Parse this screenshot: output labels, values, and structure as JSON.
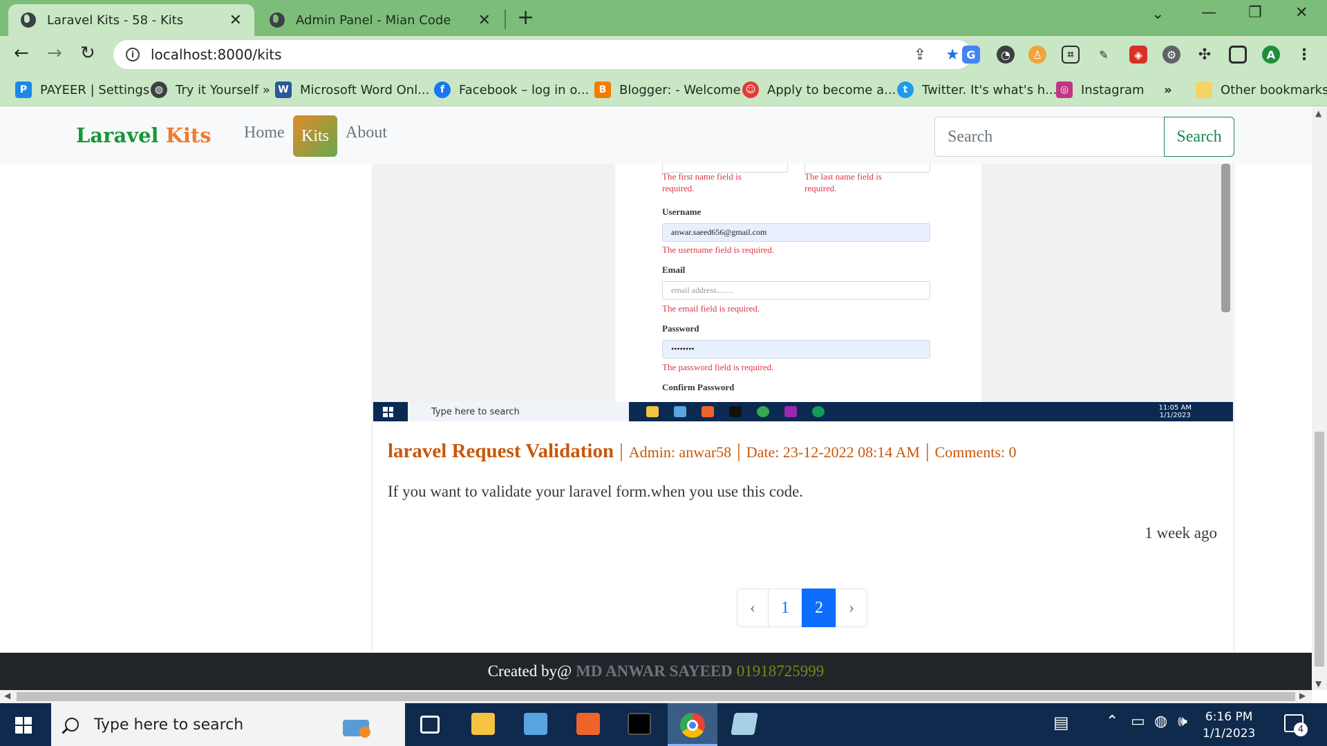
{
  "browser": {
    "tabs": [
      {
        "title": "Laravel Kits - 58 - Kits",
        "active": true
      },
      {
        "title": "Admin Panel - Mian Code",
        "active": false
      }
    ],
    "url": "localhost:8000/kits",
    "bookmarks": [
      {
        "label": "PAYEER | Settings",
        "icon": "payeer-icon",
        "color": "#1e88e5"
      },
      {
        "label": "Try it Yourself »",
        "icon": "globe-icon",
        "color": "#3c4043"
      },
      {
        "label": "Microsoft Word Onl...",
        "icon": "word-icon",
        "color": "#2b579a"
      },
      {
        "label": "Facebook – log in o...",
        "icon": "facebook-icon",
        "color": "#1877f2"
      },
      {
        "label": "Blogger: - Welcome",
        "icon": "blogger-icon",
        "color": "#f57c00"
      },
      {
        "label": "Apply to become a...",
        "icon": "smiley-icon",
        "color": "#e53935"
      },
      {
        "label": "Twitter. It's what's h...",
        "icon": "twitter-icon",
        "color": "#1d9bf0"
      },
      {
        "label": "Instagram",
        "icon": "instagram-icon",
        "color": "#c13584"
      }
    ],
    "bookmarks_overflow": "»",
    "other_bookmarks": "Other bookmarks"
  },
  "site": {
    "brand_part1": "Laravel",
    "brand_part2": "Kits",
    "nav": {
      "home": "Home",
      "kits": "Kits",
      "about": "About"
    },
    "search_placeholder": "Search",
    "search_button": "Search"
  },
  "post": {
    "screenshot": {
      "first_name_error": "The first name field is required.",
      "last_name_error": "The last name field is required.",
      "username_label": "Username",
      "username_value": "anwar.saeed656@gmail.com",
      "username_error": "The username field is required.",
      "email_label": "Email",
      "email_placeholder": "email address........",
      "email_error": "The email field is required.",
      "password_label": "Password",
      "password_value": "••••••••",
      "password_error": "The password field is required.",
      "confirm_label": "Confirm Password",
      "taskbar_search": "Type here to search",
      "tray_time": "11:05 AM",
      "tray_date": "1/1/2023"
    },
    "title": "laravel Request Validation",
    "admin": "Admin: anwar58",
    "date": "Date: 23-12-2022 08:14 AM",
    "comments": "Comments: 0",
    "separator": "|",
    "description": "If you want to validate your laravel form.when you use this code.",
    "time_ago": "1 week ago"
  },
  "pagination": {
    "prev": "‹",
    "pages": [
      "1",
      "2"
    ],
    "current": "2",
    "next": "›"
  },
  "footer": {
    "created_by": "Created by@",
    "author": "MD ANWAR SAYEED",
    "phone": "01918725999"
  },
  "taskbar": {
    "search_placeholder": "Type here to search",
    "time": "6:16 PM",
    "date": "1/1/2023",
    "notifications": "4"
  },
  "colors": {
    "brand_green": "#17963a",
    "brand_orange": "#ef7b2f",
    "post_title": "#c8570c",
    "page_active": "#0d6efd",
    "tab_strip": "#7dbd7a"
  }
}
